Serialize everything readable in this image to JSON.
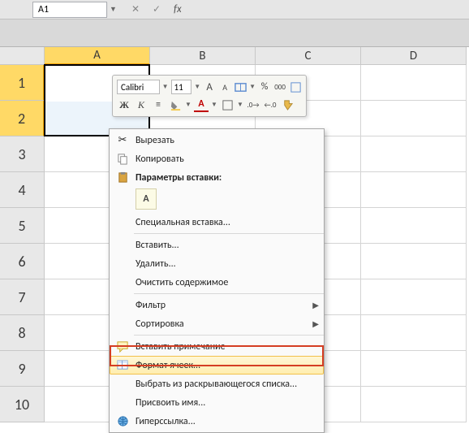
{
  "namebox": {
    "value": "A1",
    "fx": "fx"
  },
  "columns": [
    "A",
    "B",
    "C",
    "D"
  ],
  "rows": [
    "1",
    "2",
    "3",
    "4",
    "5",
    "6",
    "7",
    "8",
    "9",
    "10"
  ],
  "mini": {
    "font": "Calibri",
    "size": "11",
    "increase": "A",
    "decrease": "A",
    "bold": "Ж",
    "italic": "К"
  },
  "menu": {
    "cut": "Вырезать",
    "copy": "Копировать",
    "pasteOptionsHeader": "Параметры вставки:",
    "pasteBtn": "A",
    "pasteSpecial": "Специальная вставка...",
    "insert": "Вставить...",
    "delete": "Удалить...",
    "clear": "Очистить содержимое",
    "filter": "Фильтр",
    "sort": "Сортировка",
    "comment": "Вставить примечание",
    "format": "Формат ячеек...",
    "dropdown": "Выбрать из раскрывающегося списка...",
    "name": "Присвоить имя...",
    "hyperlink": "Гиперссылка..."
  }
}
